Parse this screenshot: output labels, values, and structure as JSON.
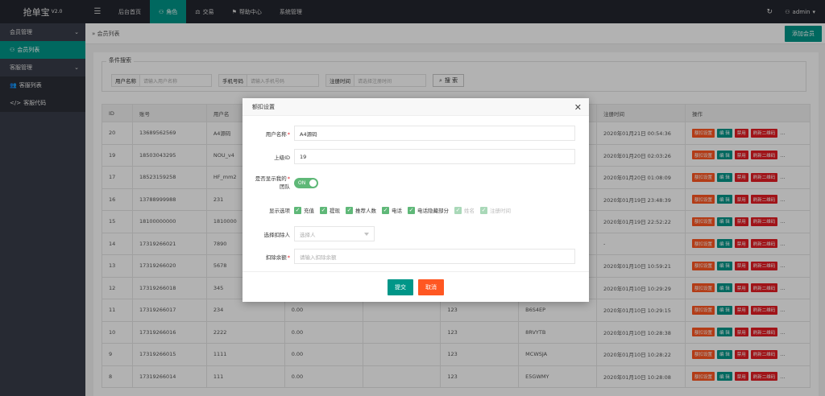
{
  "app": {
    "title": "抢单宝",
    "version": "V2.0"
  },
  "topnav": [
    {
      "label": "后台首页",
      "icon": "",
      "active": false
    },
    {
      "label": "角色",
      "icon": "user-icon",
      "active": true
    },
    {
      "label": "交易",
      "icon": "balance-icon",
      "active": false
    },
    {
      "label": "帮助中心",
      "icon": "flag-icon",
      "active": false
    },
    {
      "label": "系统管理",
      "icon": "",
      "active": false
    }
  ],
  "user": {
    "name": "admin"
  },
  "sidebar": {
    "groups": [
      {
        "label": "会员管理",
        "items": [
          {
            "label": "会员列表",
            "active": true
          }
        ]
      },
      {
        "label": "客服管理",
        "items": [
          {
            "label": "客服列表",
            "active": false
          },
          {
            "label": "客服代码",
            "active": false
          }
        ]
      }
    ]
  },
  "breadcrumb": {
    "sep": "»",
    "label": "会员列表"
  },
  "toolbar": {
    "add_label": "添加会员"
  },
  "filters": {
    "legend": "条件搜索",
    "fields": [
      {
        "label": "用户名称",
        "placeholder": "请输入用户名称"
      },
      {
        "label": "手机号码",
        "placeholder": "请输入手机号码"
      },
      {
        "label": "注册时间",
        "placeholder": "请选择注册时间"
      }
    ],
    "search_label": "搜 索"
  },
  "table": {
    "columns": [
      "ID",
      "账号",
      "用户名",
      "",
      "",
      "",
      "",
      "注册时间",
      "操作"
    ],
    "op_labels": {
      "deduct": "额扣设置",
      "edit": "编 辑",
      "disable": "禁用",
      "qr": "刷新二维码",
      "more": "..."
    },
    "rows": [
      [
        "20",
        "13689562569",
        "A4源码",
        "",
        "",
        "",
        "",
        "2020年01月21日 00:54:36"
      ],
      [
        "19",
        "18503043295",
        "NOU_v4",
        "",
        "",
        "",
        "",
        "2020年01月20日 02:03:26"
      ],
      [
        "17",
        "18523159258",
        "HF_mm2",
        "",
        "",
        "",
        "",
        "2020年01月20日 01:08:09"
      ],
      [
        "16",
        "13788999988",
        "231",
        "",
        "",
        "",
        "",
        "2020年01月19日 23:48:39"
      ],
      [
        "15",
        "18100000000",
        "1810000",
        "",
        "",
        "",
        "",
        "2020年01月19日 22:52:22"
      ],
      [
        "14",
        "17319266021",
        "7890",
        "",
        "",
        "",
        "",
        "-"
      ],
      [
        "13",
        "17319266020",
        "5678",
        "",
        "",
        "",
        "",
        "2020年01月10日 10:59:21"
      ],
      [
        "12",
        "17319266018",
        "345",
        "",
        "",
        "",
        "",
        "2020年01月10日 10:29:29"
      ],
      [
        "11",
        "17319266017",
        "234",
        "0.00",
        "",
        "123",
        "B6S4EP",
        "2020年01月10日 10:29:15"
      ],
      [
        "10",
        "17319266016",
        "2222",
        "0.00",
        "",
        "123",
        "8RVYTB",
        "2020年01月10日 10:28:38"
      ],
      [
        "9",
        "17319266015",
        "1111",
        "0.00",
        "",
        "123",
        "MCWSJA",
        "2020年01月10日 10:28:22"
      ],
      [
        "8",
        "17319266014",
        "111",
        "0.00",
        "",
        "123",
        "E5GWMY",
        "2020年01月10日 10:28:08"
      ]
    ]
  },
  "modal": {
    "title": "额扣设置",
    "fields": {
      "username": {
        "label": "用户名称",
        "value": "A4源码"
      },
      "parent_id": {
        "label": "上级ID",
        "value": "19"
      },
      "team": {
        "label_line1": "是否显示我的",
        "label_line2": "团队",
        "switch_text": "ON"
      },
      "display": {
        "label": "显示选项",
        "options": [
          {
            "label": "充值",
            "checked": true
          },
          {
            "label": "提现",
            "checked": true
          },
          {
            "label": "推荐人数",
            "checked": true
          },
          {
            "label": "电话",
            "checked": true
          },
          {
            "label": "电话隐藏部分",
            "checked": true
          },
          {
            "label": "姓名",
            "checked": false
          },
          {
            "label": "注册时间",
            "checked": false
          }
        ]
      },
      "deduct_person": {
        "label": "选择扣除人",
        "placeholder": "选择人"
      },
      "deduct_amount": {
        "label": "扣除余额",
        "placeholder": "请输入扣除余额"
      }
    },
    "submit_label": "提交",
    "cancel_label": "取消"
  },
  "colors": {
    "accent": "#009688",
    "warn": "#ff5722",
    "danger": "#e51c23",
    "sidebar": "#393d49",
    "topbar": "#23262e"
  }
}
